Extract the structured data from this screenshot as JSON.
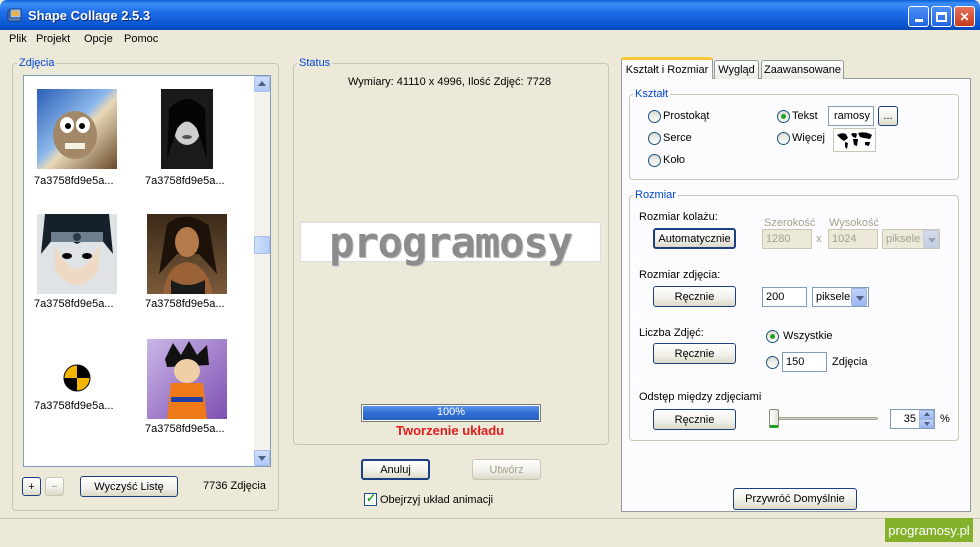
{
  "window": {
    "title": "Shape Collage 2.5.3"
  },
  "menu": [
    "Plik",
    "Projekt",
    "Opcje",
    "Pomoc"
  ],
  "photos": {
    "legend": "Zdjęcia",
    "items": [
      {
        "caption": "7a3758fd9e5a..."
      },
      {
        "caption": "7a3758fd9e5a..."
      },
      {
        "caption": "7a3758fd9e5a..."
      },
      {
        "caption": "7a3758fd9e5a..."
      },
      {
        "caption": "7a3758fd9e5a..."
      },
      {
        "caption": "7a3758fd9e5a..."
      }
    ],
    "add_label": "+",
    "remove_label": "−",
    "clear_label": "Wyczyść Listę",
    "count": "7736 Zdjęcia"
  },
  "status": {
    "legend": "Status",
    "dimensions": "Wymiary: 41110 x 4996, Ilość Zdjęć: 7728",
    "preview_text": "programosy",
    "progress_text": "100%",
    "progress_value": 1.0,
    "state_text": "Tworzenie układu",
    "cancel_label": "Anuluj",
    "create_label": "Utwórz",
    "animate_label": "Obejrzyj układ animacji",
    "animate_checked": true
  },
  "tabs": [
    "Kształt i Rozmiar",
    "Wygląd",
    "Zaawansowane"
  ],
  "shape": {
    "legend": "Kształt",
    "options": {
      "rect": "Prostokąt",
      "heart": "Serce",
      "circle": "Koło",
      "text": "Tekst",
      "more": "Więcej"
    },
    "selected": "text",
    "text_value": "ramosy",
    "browse_label": "..."
  },
  "size": {
    "legend": "Rozmiar",
    "collage_label": "Rozmiar kolażu:",
    "collage_button": "Automatycznie",
    "width_label": "Szerokość",
    "height_label": "Wysokość",
    "width_value": "1280",
    "height_value": "1024",
    "times": "x",
    "collage_unit": "piksele",
    "photo_label": "Rozmiar zdjęcia:",
    "photo_button": "Ręcznie",
    "photo_value": "200",
    "photo_unit": "piksele",
    "count_label": "Liczba Zdjęć:",
    "count_button": "Ręcznie",
    "count_all": "Wszystkie",
    "count_value": "150",
    "count_unit": "Zdjęcia",
    "count_selected": "all",
    "spacing_label": "Odstęp między zdjęciami",
    "spacing_button": "Ręcznie",
    "spacing_value": "35",
    "spacing_unit": "%",
    "spacing_fraction": 0.0
  },
  "restore_label": "Przywróć Domyślnie",
  "watermark": "programosy.pl",
  "colors": {
    "accent": "#0046d5",
    "status_red": "#e21b1b",
    "progress": "#2f6fd6",
    "watermark_bg": "#84b12b"
  }
}
